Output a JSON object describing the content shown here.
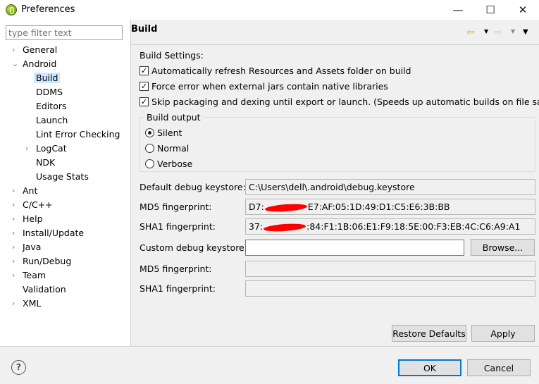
{
  "window": {
    "title": "Preferences",
    "min": "—",
    "max": "☐",
    "close": "✕"
  },
  "filter": {
    "placeholder": "type filter text"
  },
  "tree": [
    {
      "label": "General",
      "level": 0,
      "twisty": "›"
    },
    {
      "label": "Android",
      "level": 0,
      "twisty": "⌄"
    },
    {
      "label": "Build",
      "level": 1,
      "selected": true
    },
    {
      "label": "DDMS",
      "level": 1
    },
    {
      "label": "Editors",
      "level": 1
    },
    {
      "label": "Launch",
      "level": 1
    },
    {
      "label": "Lint Error Checking",
      "level": 1
    },
    {
      "label": "LogCat",
      "level": 1,
      "twisty": "›"
    },
    {
      "label": "NDK",
      "level": 1
    },
    {
      "label": "Usage Stats",
      "level": 1
    },
    {
      "label": "Ant",
      "level": 0,
      "twisty": "›"
    },
    {
      "label": "C/C++",
      "level": 0,
      "twisty": "›"
    },
    {
      "label": "Help",
      "level": 0,
      "twisty": "›"
    },
    {
      "label": "Install/Update",
      "level": 0,
      "twisty": "›"
    },
    {
      "label": "Java",
      "level": 0,
      "twisty": "›"
    },
    {
      "label": "Run/Debug",
      "level": 0,
      "twisty": "›"
    },
    {
      "label": "Team",
      "level": 0,
      "twisty": "›"
    },
    {
      "label": "Validation",
      "level": 0
    },
    {
      "label": "XML",
      "level": 0,
      "twisty": "›"
    }
  ],
  "page": {
    "title": "Build",
    "settings_label": "Build Settings:",
    "checks": [
      {
        "label": "Automatically refresh Resources and Assets folder on build",
        "checked": true
      },
      {
        "label": "Force error when external jars contain native libraries",
        "checked": true
      },
      {
        "label": "Skip packaging and dexing until export or launch. (Speeds up automatic builds on file save)",
        "checked": true
      }
    ],
    "output_group": "Build output",
    "radios": [
      {
        "label": "Silent",
        "selected": true
      },
      {
        "label": "Normal",
        "selected": false
      },
      {
        "label": "Verbose",
        "selected": false
      }
    ],
    "default_keystore_label": "Default debug keystore:",
    "default_keystore": "C:\\Users\\dell\\.android\\debug.keystore",
    "md5_label": "MD5 fingerprint:",
    "md5_prefix": "D7:",
    "md5_suffix": "E7:AF:05:1D:49:D1:C5:E6:3B:BB",
    "sha1_label": "SHA1 fingerprint:",
    "sha1_prefix": "37:",
    "sha1_suffix": ":84:F1:1B:06:E1:F9:18:5E:00:F3:EB:4C:C6:A9:A1",
    "custom_label": "Custom debug keystore:",
    "custom_value": "",
    "browse": "Browse...",
    "md5_label2": "MD5 fingerprint:",
    "sha1_label2": "SHA1 fingerprint:",
    "restore": "Restore Defaults",
    "apply": "Apply"
  },
  "footer": {
    "help": "?",
    "ok": "OK",
    "cancel": "Cancel"
  },
  "colors": {
    "selection": "#cce8ff",
    "ok_border": "#0078d7",
    "back_arrow": "#f0c040"
  }
}
